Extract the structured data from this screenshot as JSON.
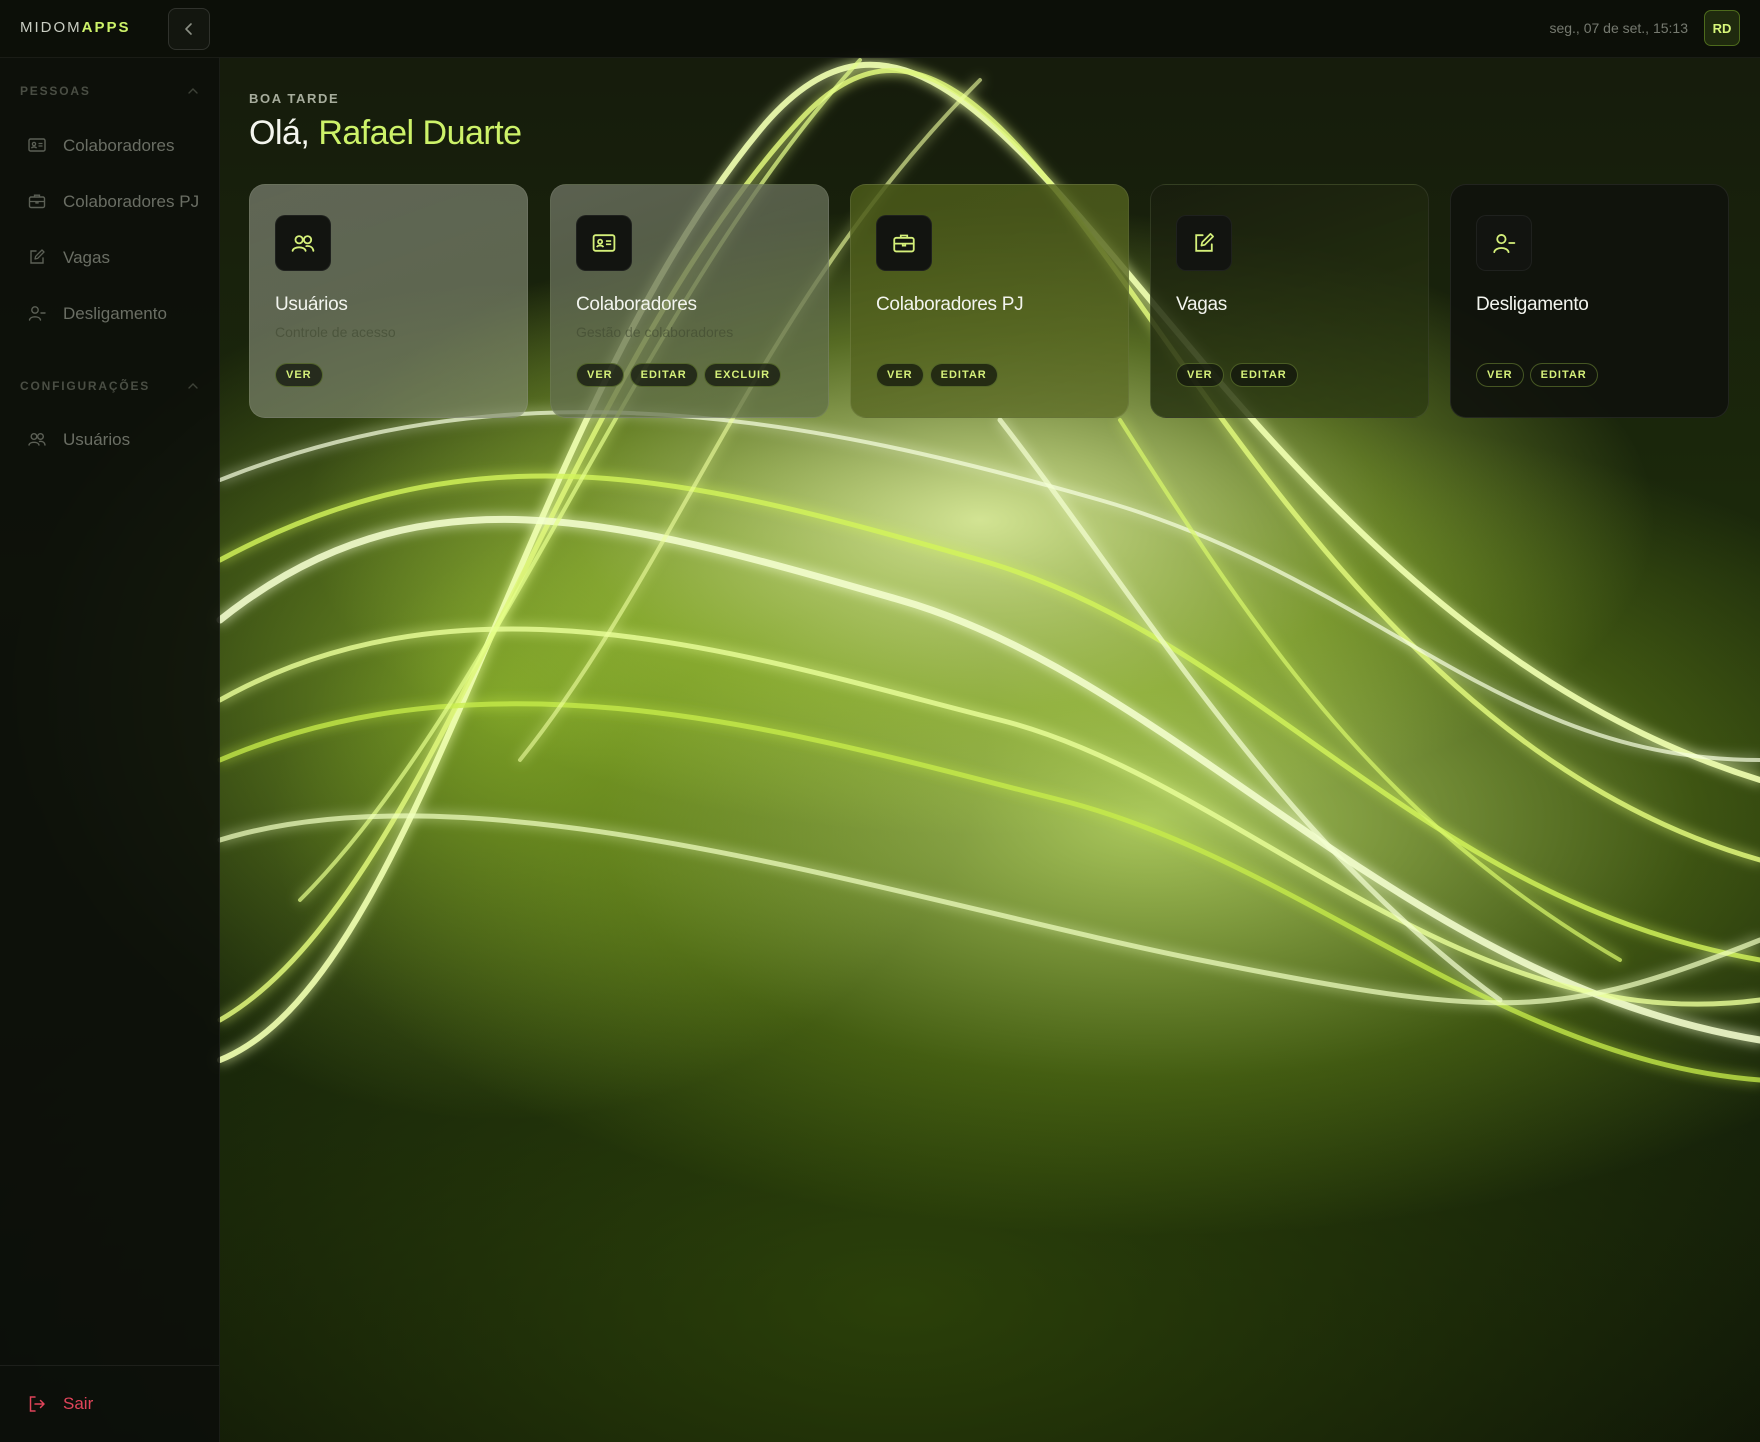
{
  "brand": {
    "part1": "MIDOM",
    "part2": "APPS"
  },
  "topbar": {
    "datetime": "seg., 07 de set., 15:13",
    "avatar_initials": "RD",
    "collapse_icon": "chevron-left-icon"
  },
  "sidebar": {
    "sections": [
      {
        "title": "PESSOAS",
        "items": [
          {
            "label": "Colaboradores",
            "icon": "id-card-icon"
          },
          {
            "label": "Colaboradores PJ",
            "icon": "briefcase-icon"
          },
          {
            "label": "Vagas",
            "icon": "edit-icon"
          },
          {
            "label": "Desligamento",
            "icon": "user-minus-icon"
          }
        ]
      },
      {
        "title": "CONFIGURAÇÕES",
        "items": [
          {
            "label": "Usuários",
            "icon": "users-icon"
          }
        ]
      }
    ],
    "logout_label": "Sair"
  },
  "main": {
    "greeting_sub": "BOA TARDE",
    "greeting_prefix": "Olá,",
    "user_name": "Rafael Duarte",
    "cards": [
      {
        "title": "Usuários",
        "description": "Controle de acesso",
        "icon": "users-icon",
        "actions": [
          "VER"
        ]
      },
      {
        "title": "Colaboradores",
        "description": "Gestão de colaboradores",
        "icon": "id-card-icon",
        "actions": [
          "VER",
          "EDITAR",
          "EXCLUIR"
        ]
      },
      {
        "title": "Colaboradores PJ",
        "description": "",
        "icon": "briefcase-icon",
        "actions": [
          "VER",
          "EDITAR"
        ]
      },
      {
        "title": "Vagas",
        "description": "",
        "icon": "edit-icon",
        "actions": [
          "VER",
          "EDITAR"
        ]
      },
      {
        "title": "Desligamento",
        "description": "",
        "icon": "user-minus-icon",
        "actions": [
          "VER",
          "EDITAR"
        ]
      }
    ]
  },
  "colors": {
    "accent": "#cdf269",
    "danger": "#e0445a",
    "sidebar_bg": "#0c0e0a"
  }
}
